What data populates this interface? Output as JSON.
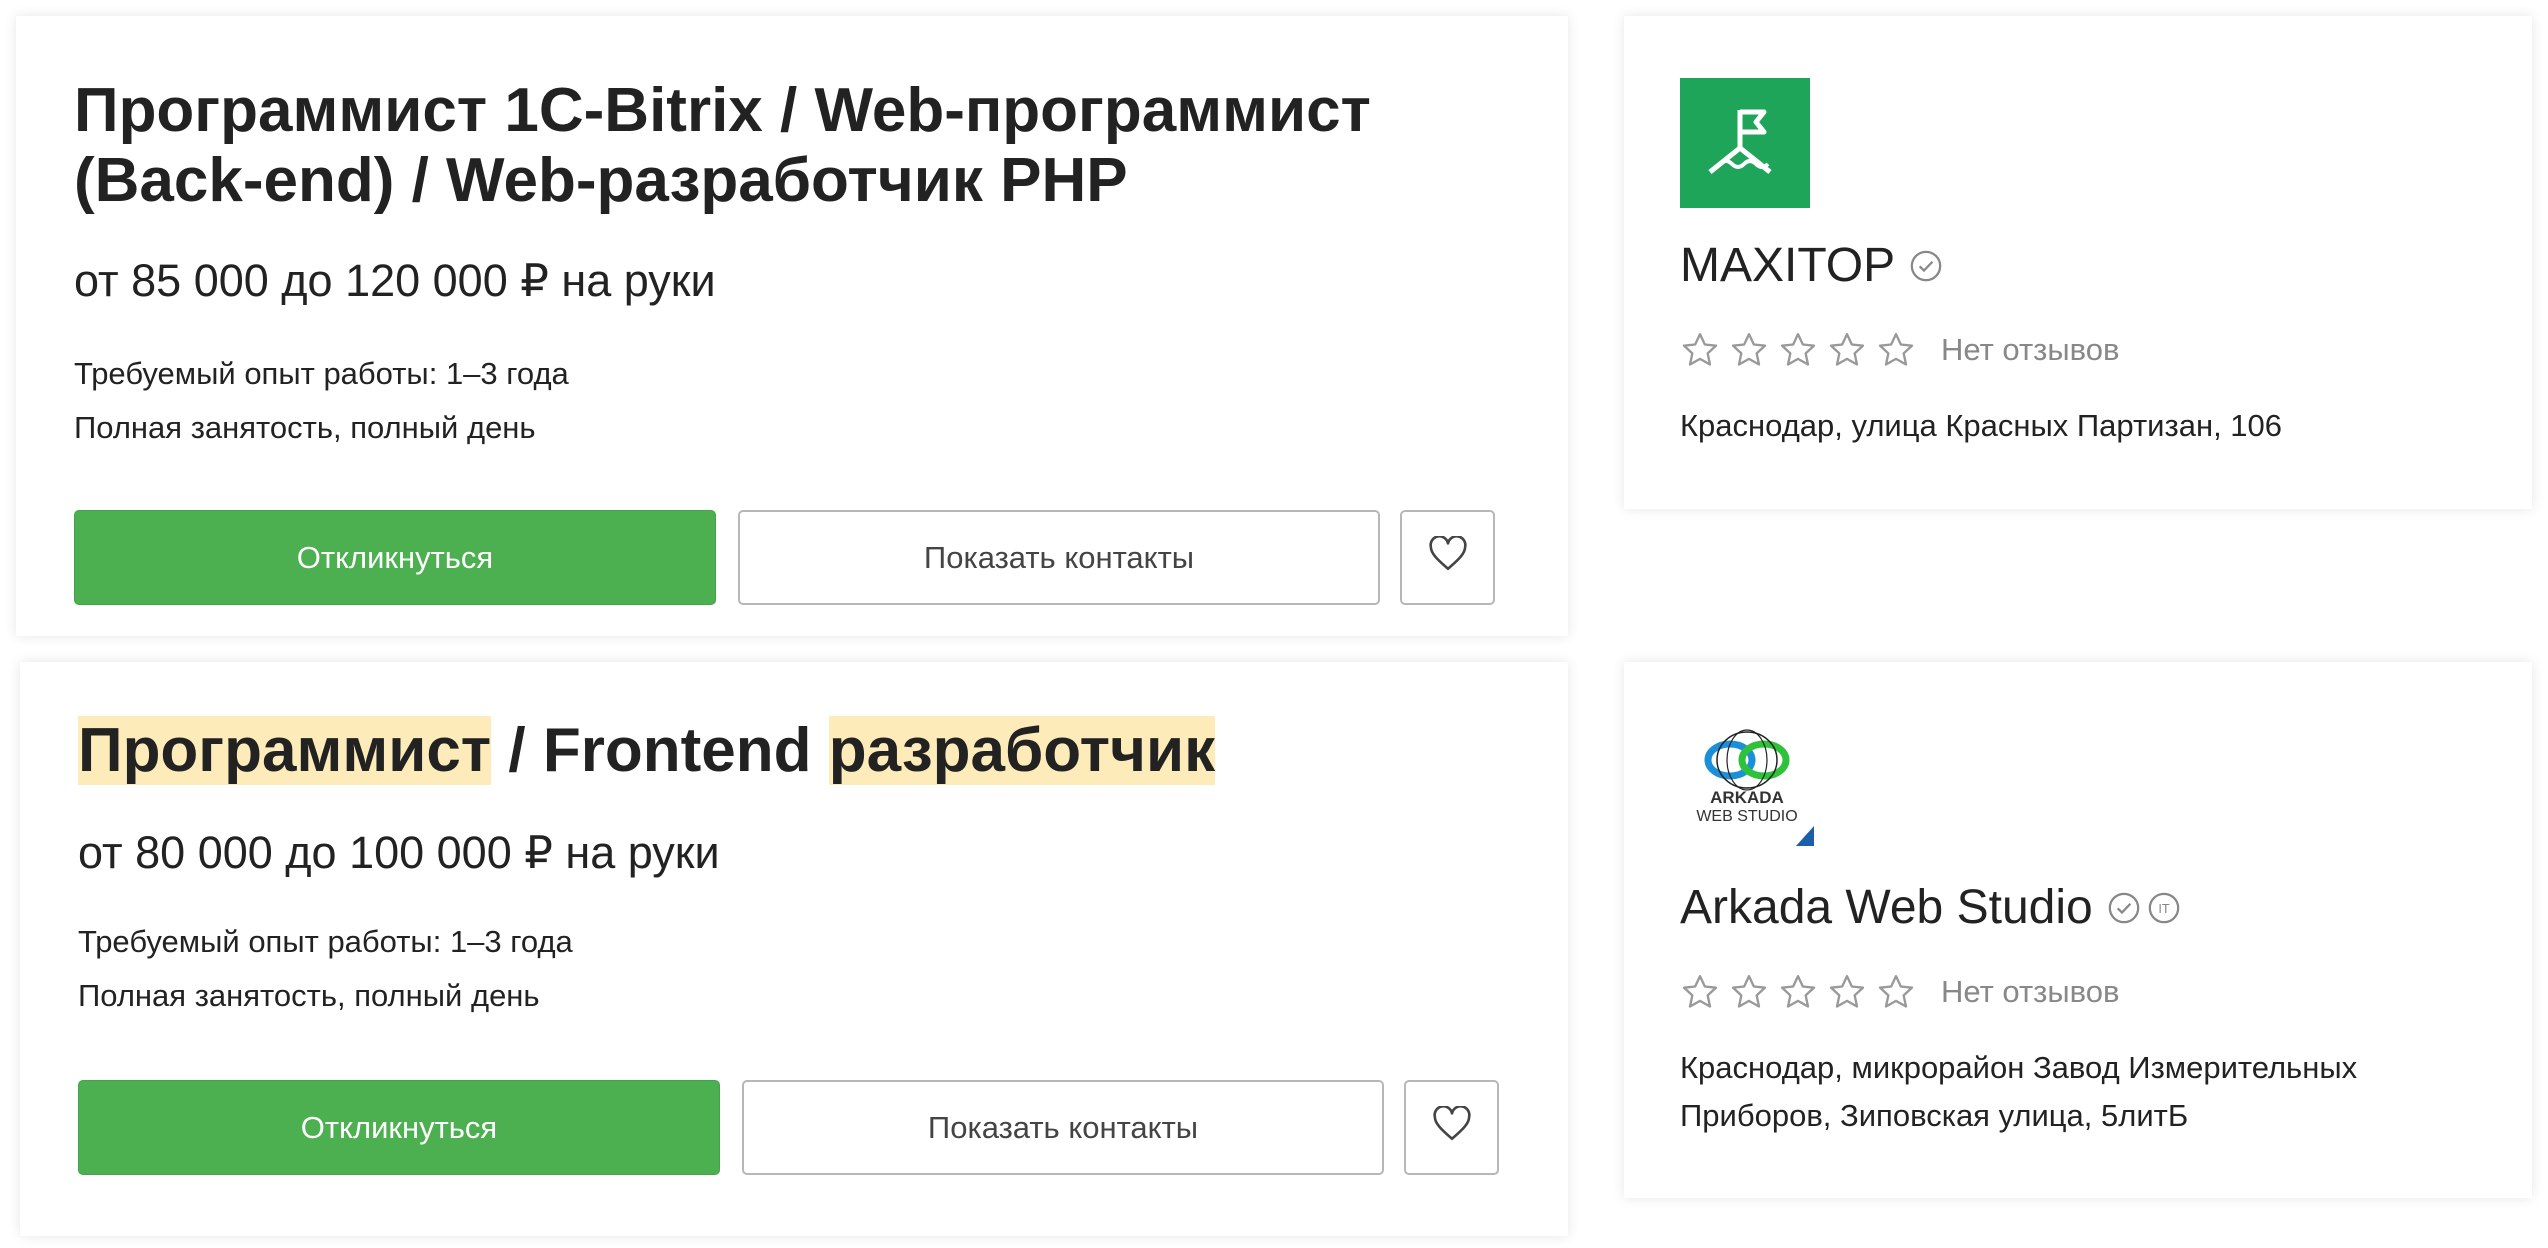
{
  "vacancies": [
    {
      "title": "Программист 1С-Bitrix / Web-программист (Back-end) / Web-разработчик PHP",
      "salary": "от 85 000 до 120 000 ₽ на руки",
      "experience": "Требуемый опыт работы: 1–3 года",
      "employment": "Полная занятость, полный день",
      "respond_label": "Откликнуться",
      "contacts_label": "Показать контакты",
      "favorite_icon": "heart-icon"
    },
    {
      "title_parts": {
        "part1": "Программист",
        "sep": " / Frontend ",
        "part2": "разработчик"
      },
      "salary": "от 80 000 до 100 000 ₽ на руки",
      "experience": "Требуемый опыт работы: 1–3 года",
      "employment": "Полная занятость, полный день",
      "respond_label": "Откликнуться",
      "contacts_label": "Показать контакты",
      "favorite_icon": "heart-icon"
    }
  ],
  "employers": [
    {
      "name": "MAXITOP",
      "reviews": "Нет отзывов",
      "address": "Краснодар, улица Красных Партизан, 106",
      "logo_color": "#1fa55a"
    },
    {
      "name": "Arkada Web Studio",
      "reviews": "Нет отзывов",
      "address": "Краснодар, микрорайон Завод Измерительных Приборов, Зиповская улица, 5литБ",
      "logo_text_1": "ARKADA",
      "logo_text_2": "WEB STUDIO",
      "it_badge": "IT"
    }
  ],
  "colors": {
    "respond_button": "#4caf50",
    "highlight": "#fdecba",
    "muted_text": "#888888"
  }
}
